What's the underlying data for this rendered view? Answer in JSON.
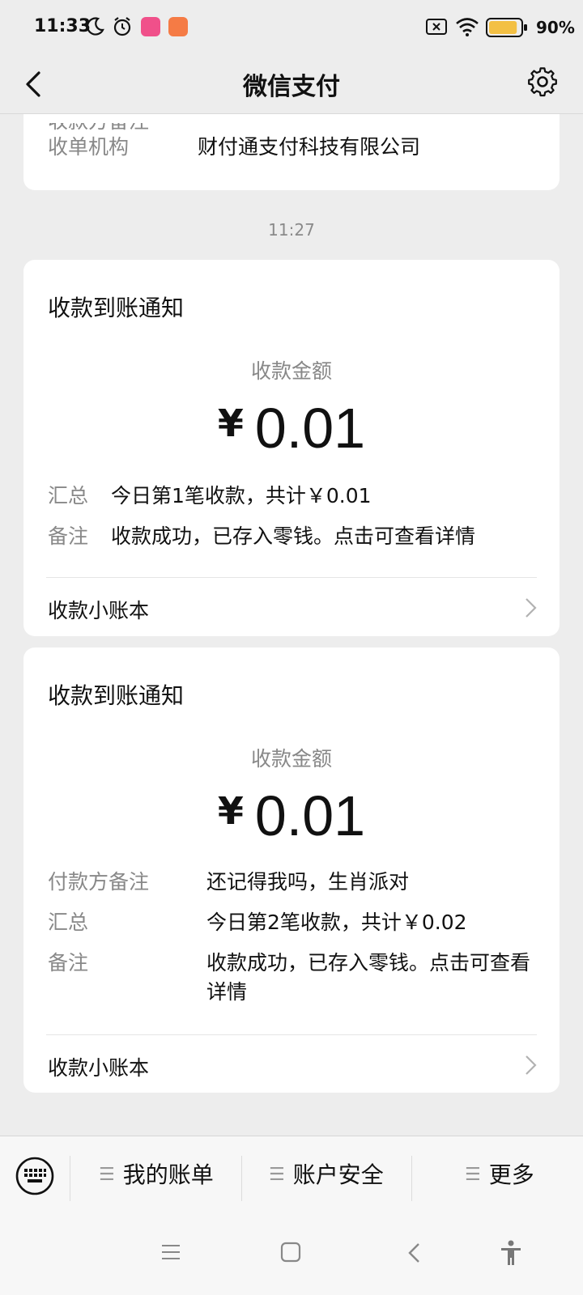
{
  "status": {
    "time": "11:33",
    "battery_pct": "90%",
    "battery_level": 0.9
  },
  "nav": {
    "title": "微信支付"
  },
  "prev_card": {
    "cut_text": "收款方备注",
    "label": "收单机构",
    "value": "财付通支付科技有限公司"
  },
  "time_separator": "11:27",
  "cards": [
    {
      "title": "收款到账通知",
      "amount_label": "收款金额",
      "currency": "¥",
      "amount": "0.01",
      "rows": [
        {
          "label": "汇总",
          "value": "今日第1笔收款，共计￥0.01"
        },
        {
          "label": "备注",
          "value": "收款成功，已存入零钱。点击可查看详情"
        }
      ],
      "footer": "收款小账本"
    },
    {
      "title": "收款到账通知",
      "amount_label": "收款金额",
      "currency": "¥",
      "amount": "0.01",
      "rows": [
        {
          "label": "付款方备注",
          "value": "还记得我吗，生肖派对"
        },
        {
          "label": "汇总",
          "value": "今日第2笔收款，共计￥0.02"
        },
        {
          "label": "备注",
          "value": "收款成功，已存入零钱。点击可查看详情"
        }
      ],
      "footer": "收款小账本"
    }
  ],
  "menu": {
    "items": [
      "我的账单",
      "账户安全",
      "更多"
    ]
  },
  "colors": {
    "background": "#ededed",
    "card": "#ffffff",
    "muted_text": "#888888",
    "battery_fill": "#f3c044"
  }
}
